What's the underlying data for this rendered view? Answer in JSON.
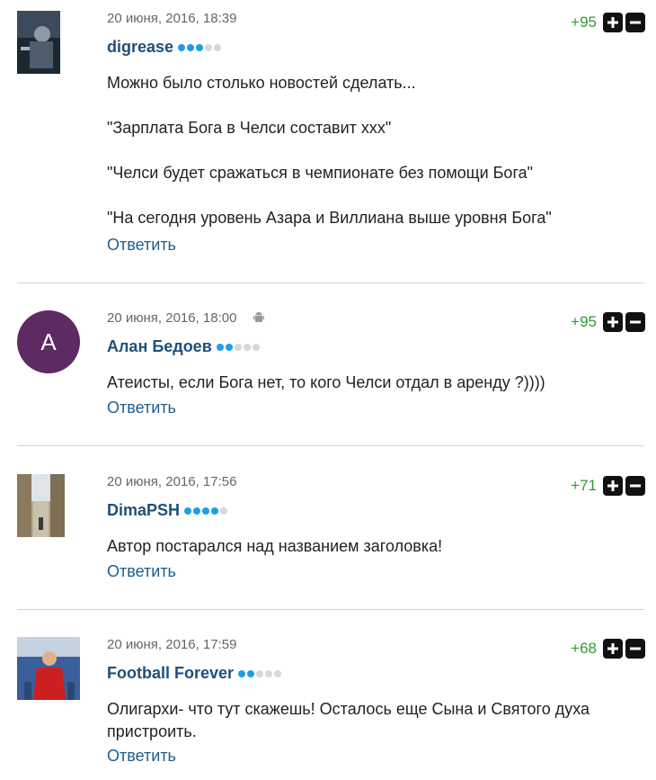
{
  "comments": [
    {
      "date": "20 июня, 2016, 18:39",
      "author": "digrease",
      "rank_dots": 5,
      "rank_filled": 3,
      "score": "+95",
      "paragraphs": [
        "Можно было столько новостей сделать...",
        "\"Зарплата Бога в Челси составит ххх\"",
        "\"Челси будет сражаться в чемпионате без помощи Бога\"",
        "\"На сегодня уровень Азара и Виллиана выше уровня Бога\""
      ],
      "reply": "Ответить"
    },
    {
      "date": "20 июня, 2016, 18:00",
      "device_icon": "android-icon",
      "author": "Алан Бедоев",
      "avatar_letter": "А",
      "avatar_color": "#5e2a62",
      "rank_dots": 5,
      "rank_filled": 2,
      "score": "+95",
      "paragraphs": [
        "Атеисты, если Бога нет, то кого Челси отдал в аренду ?))))"
      ],
      "reply": "Ответить"
    },
    {
      "date": "20 июня, 2016, 17:56",
      "author": "DimaPSH",
      "rank_dots": 5,
      "rank_filled": 4,
      "score": "+71",
      "paragraphs": [
        "Автор постарался над названием заголовка!"
      ],
      "reply": "Ответить"
    },
    {
      "date": "20 июня, 2016, 17:59",
      "author": "Football Forever",
      "rank_dots": 5,
      "rank_filled": 2,
      "score": "+68",
      "paragraphs": [
        "Олигархи- что тут скажешь! Осталось еще Сына и Святого духа пристроить."
      ],
      "reply": "Ответить"
    }
  ],
  "colors": {
    "score": "#2f9a2f",
    "author": "#1f4f7a",
    "reply": "#1f5e8e",
    "rank_on": "#1e9ee6",
    "rank_off": "#d8d8d8"
  },
  "icons": [
    "plus-icon",
    "minus-icon",
    "android-icon"
  ]
}
